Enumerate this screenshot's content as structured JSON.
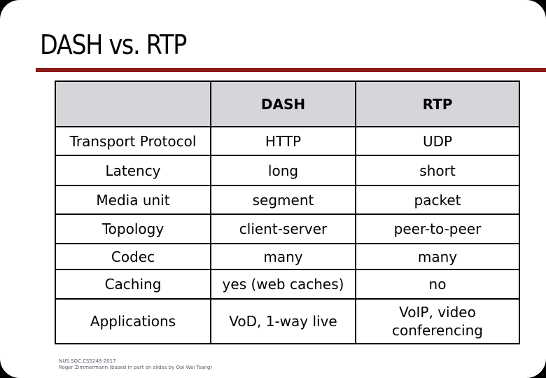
{
  "slide": {
    "title": "DASH vs. RTP",
    "accent_color": "#8b1a1a",
    "header_fill": "#d6d6da"
  },
  "table": {
    "headers": [
      "",
      "DASH",
      "RTP"
    ],
    "rows": [
      {
        "label": "Transport Protocol",
        "dash": "HTTP",
        "rtp": "UDP"
      },
      {
        "label": "Latency",
        "dash": "long",
        "rtp": "short"
      },
      {
        "label": "Media unit",
        "dash": "segment",
        "rtp": "packet"
      },
      {
        "label": "Topology",
        "dash": "client-server",
        "rtp": "peer-to-peer"
      },
      {
        "label": "Codec",
        "dash": "many",
        "rtp": "many"
      },
      {
        "label": "Caching",
        "dash": "yes (web caches)",
        "rtp": "no"
      },
      {
        "label": "Applications",
        "dash": "VoD, 1-way live",
        "rtp": "VoIP, video conferencing"
      }
    ]
  },
  "footer": {
    "line1": "NUS.SOC.CS5248-2017",
    "line2": "Roger Zimmermann (based in part on slides by Ooi Wei Tsang)"
  }
}
